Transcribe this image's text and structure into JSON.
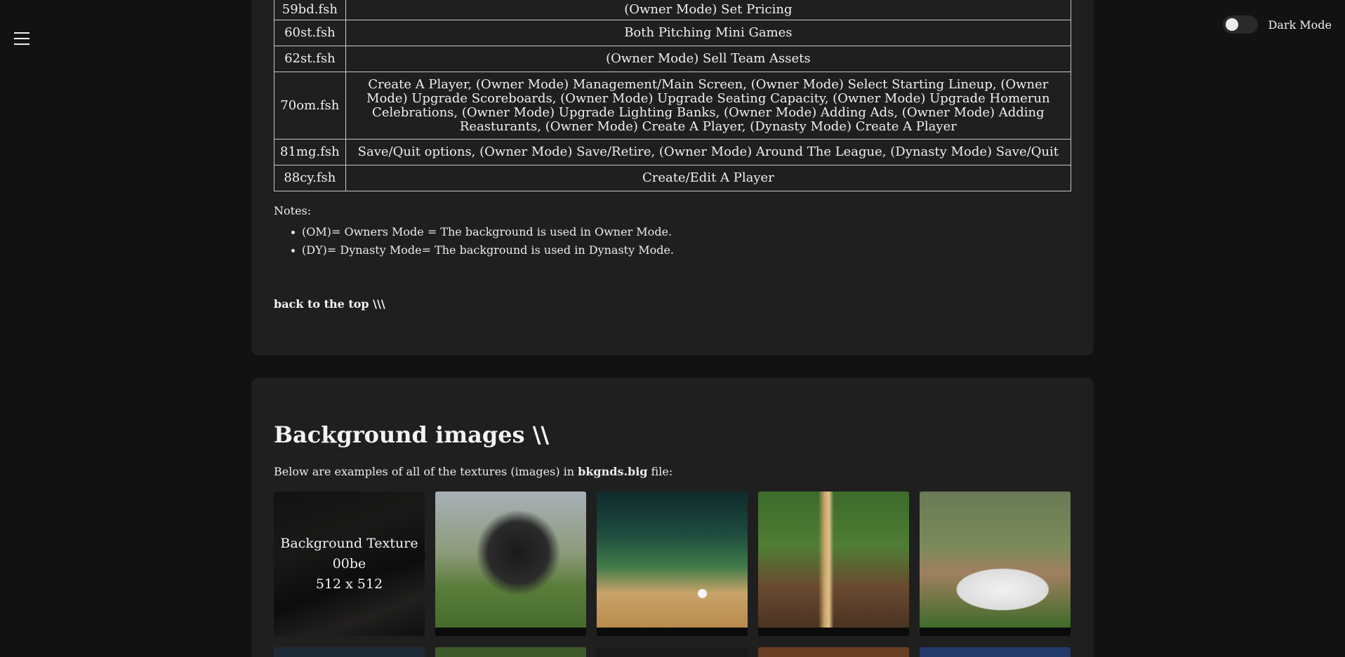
{
  "header": {
    "dark_mode_label": "Dark Mode"
  },
  "file_table": [
    {
      "file": "59bd.fsh",
      "usage": "(Owner Mode) Set Pricing"
    },
    {
      "file": "60st.fsh",
      "usage": "Both Pitching Mini Games"
    },
    {
      "file": "62st.fsh",
      "usage": "(Owner Mode) Sell Team Assets"
    },
    {
      "file": "70om.fsh",
      "usage": "Create A Player, (Owner Mode) Management/Main Screen, (Owner Mode) Select Starting Lineup, (Owner Mode) Upgrade Scoreboards, (Owner Mode) Upgrade Seating Capacity, (Owner Mode) Upgrade Homerun Celebrations, (Owner Mode) Upgrade Lighting Banks, (Owner Mode) Adding Ads, (Owner Mode) Adding Reasturants, (Owner Mode) Create A Player, (Dynasty Mode) Create A Player"
    },
    {
      "file": "81mg.fsh",
      "usage": "Save/Quit options, (Owner Mode) Save/Retire, (Owner Mode) Around The League, (Dynasty Mode) Save/Quit"
    },
    {
      "file": "88cy.fsh",
      "usage": "Create/Edit A Player"
    }
  ],
  "notes": {
    "label": "Notes:",
    "items": [
      "(OM)= Owners Mode = The background is used in Owner Mode.",
      "(DY)= Dynasty Mode= The background is used in Dynasty Mode."
    ]
  },
  "back_to_top": "back to the top \\\\\\",
  "background_section": {
    "title": "Background images \\\\",
    "desc_prefix": "Below are examples of all of the textures (images) in ",
    "desc_file": "bkgnds.big",
    "desc_suffix": " file:",
    "hover_caption": {
      "line1": "Background Texture",
      "line2": "00be",
      "line3": "512 x 512"
    }
  }
}
